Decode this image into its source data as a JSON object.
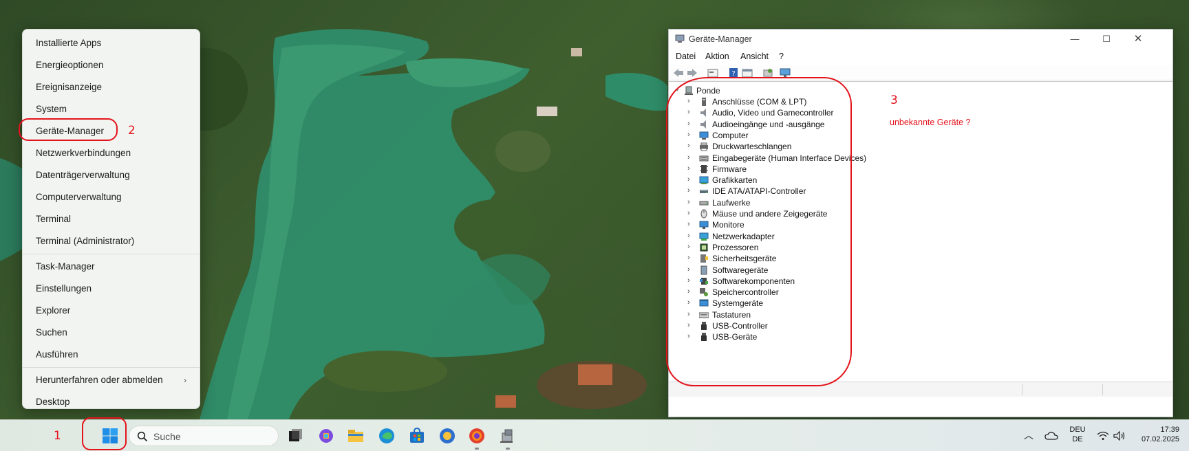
{
  "winx_menu": {
    "items": [
      "Installierte Apps",
      "Energieoptionen",
      "Ereignisanzeige",
      "System",
      "Geräte-Manager",
      "Netzwerkverbindungen",
      "Datenträgerverwaltung",
      "Computerverwaltung",
      "Terminal",
      "Terminal (Administrator)",
      "Task-Manager",
      "Einstellungen",
      "Explorer",
      "Suchen",
      "Ausführen",
      "Herunterfahren oder abmelden",
      "Desktop"
    ]
  },
  "annotations": {
    "num1": "1",
    "num2": "2",
    "num3": "3",
    "note": "unbekannte Geräte ?",
    "color": "#e3131b"
  },
  "device_manager": {
    "title": "Geräte-Manager",
    "menu": [
      "Datei",
      "Aktion",
      "Ansicht",
      "?"
    ],
    "root": "Ponde",
    "categories": [
      {
        "label": "Anschlüsse (COM & LPT)",
        "icon": "port-icon"
      },
      {
        "label": "Audio, Video und Gamecontroller",
        "icon": "speaker-icon"
      },
      {
        "label": "Audioeingänge und -ausgänge",
        "icon": "speaker-icon"
      },
      {
        "label": "Computer",
        "icon": "computer-icon"
      },
      {
        "label": "Druckwarteschlangen",
        "icon": "printer-icon"
      },
      {
        "label": "Eingabegeräte (Human Interface Devices)",
        "icon": "hid-icon"
      },
      {
        "label": "Firmware",
        "icon": "firmware-icon"
      },
      {
        "label": "Grafikkarten",
        "icon": "display-adapter-icon"
      },
      {
        "label": "IDE ATA/ATAPI-Controller",
        "icon": "ide-icon"
      },
      {
        "label": "Laufwerke",
        "icon": "drive-icon"
      },
      {
        "label": "Mäuse und andere Zeigegeräte",
        "icon": "mouse-icon"
      },
      {
        "label": "Monitore",
        "icon": "monitor-icon"
      },
      {
        "label": "Netzwerkadapter",
        "icon": "network-adapter-icon"
      },
      {
        "label": "Prozessoren",
        "icon": "processor-icon"
      },
      {
        "label": "Sicherheitsgeräte",
        "icon": "security-icon"
      },
      {
        "label": "Softwaregeräte",
        "icon": "software-device-icon"
      },
      {
        "label": "Softwarekomponenten",
        "icon": "software-component-icon"
      },
      {
        "label": "Speichercontroller",
        "icon": "storage-controller-icon"
      },
      {
        "label": "Systemgeräte",
        "icon": "system-device-icon"
      },
      {
        "label": "Tastaturen",
        "icon": "keyboard-icon"
      },
      {
        "label": "USB-Controller",
        "icon": "usb-icon"
      },
      {
        "label": "USB-Geräte",
        "icon": "usb-icon"
      }
    ]
  },
  "taskbar": {
    "search_placeholder": "Suche",
    "lang_top": "DEU",
    "lang_bottom": "DE",
    "time": "17:39",
    "date": "07.02.2025"
  }
}
